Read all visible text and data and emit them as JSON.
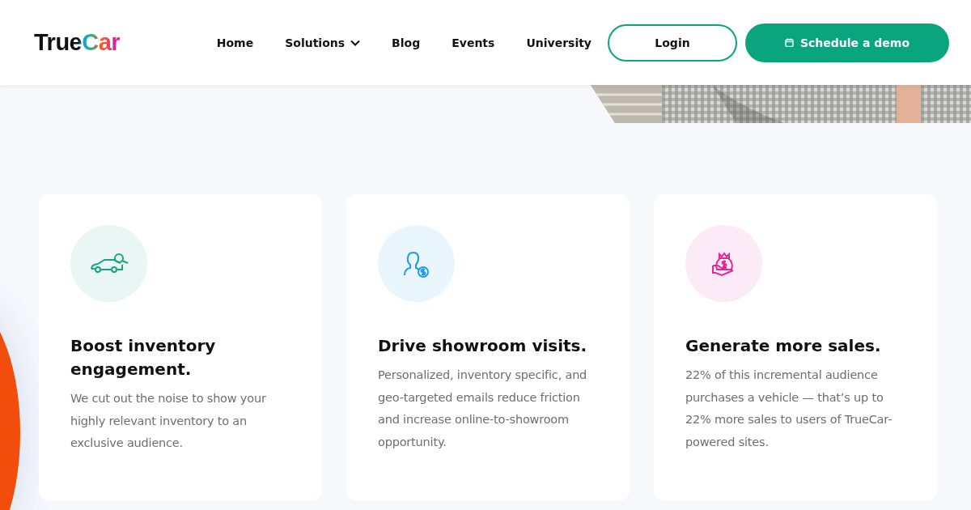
{
  "header": {
    "logo": "TrueCar",
    "nav": [
      {
        "label": "Home",
        "has_menu": false
      },
      {
        "label": "Solutions",
        "has_menu": true
      },
      {
        "label": "Blog",
        "has_menu": false
      },
      {
        "label": "Events",
        "has_menu": false
      },
      {
        "label": "University",
        "has_menu": false
      }
    ],
    "login": "Login",
    "demo": "Schedule a demo"
  },
  "cards": [
    {
      "kind": "car",
      "color": "#1aa383",
      "title": "Boost inventory engagement.",
      "body": "We cut out the noise to show your highly relevant inventory to an exclusive audience."
    },
    {
      "kind": "person",
      "color": "#1e9be6",
      "title": "Drive showroom visits.",
      "body": "Personalized, inventory specific, and geo-targeted emails reduce friction and increase online-to-showroom opportunity."
    },
    {
      "kind": "moneybag",
      "color": "#e0279b",
      "title": "Generate more sales.",
      "body": "22% of this incremental audience purchases a vehicle — that’s up to 22% more sales to users of TrueCar-powered sites."
    }
  ]
}
